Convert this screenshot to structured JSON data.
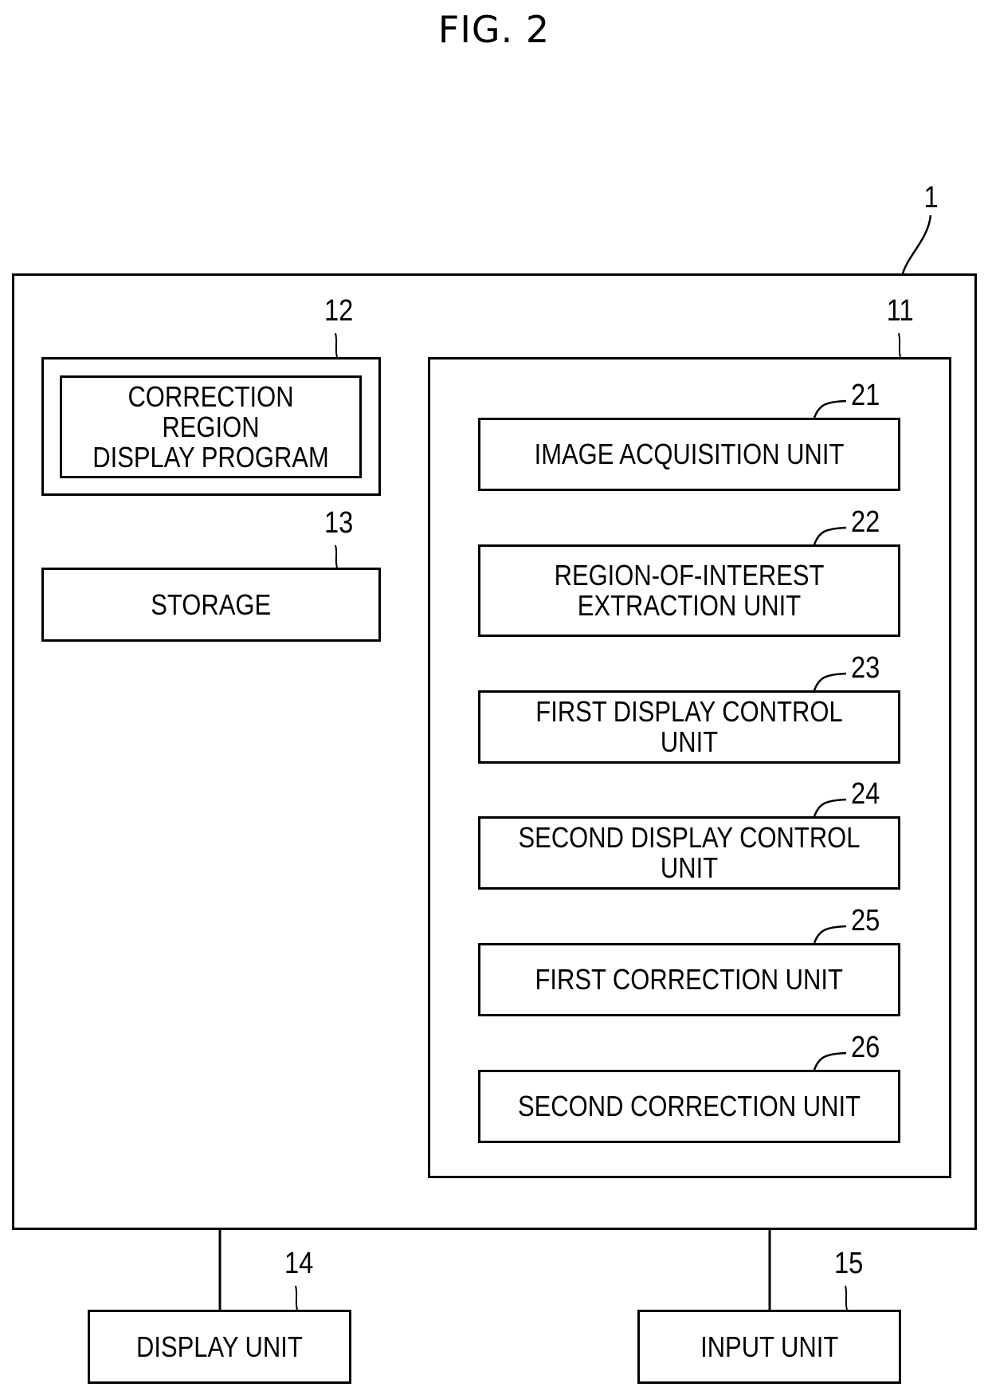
{
  "figure": {
    "title": "FIG. 2"
  },
  "device": {
    "ref": "1",
    "processor": {
      "ref": "11",
      "units": [
        {
          "ref": "21",
          "label": "IMAGE ACQUISITION UNIT"
        },
        {
          "ref": "22",
          "label": "REGION-OF-INTEREST\nEXTRACTION UNIT"
        },
        {
          "ref": "23",
          "label": "FIRST DISPLAY CONTROL UNIT"
        },
        {
          "ref": "24",
          "label": "SECOND DISPLAY CONTROL UNIT"
        },
        {
          "ref": "25",
          "label": "FIRST CORRECTION UNIT"
        },
        {
          "ref": "26",
          "label": "SECOND CORRECTION UNIT"
        }
      ]
    },
    "memory": {
      "ref": "12",
      "program_label": "CORRECTION REGION\nDISPLAY PROGRAM"
    },
    "storage": {
      "ref": "13",
      "label": "STORAGE"
    }
  },
  "peripherals": {
    "display": {
      "ref": "14",
      "label": "DISPLAY UNIT"
    },
    "input": {
      "ref": "15",
      "label": "INPUT UNIT"
    }
  }
}
